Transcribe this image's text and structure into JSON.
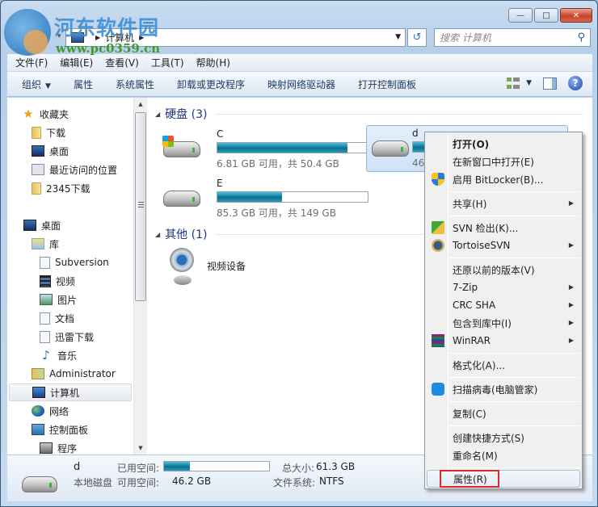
{
  "watermark": {
    "title": "河东软件园",
    "url": "www.pc0359.cn"
  },
  "window": {
    "caption": {
      "minimize": "—",
      "maximize": "□",
      "close": "✕"
    }
  },
  "address": {
    "crumbs": [
      "计算机"
    ],
    "search_placeholder": "搜索 计算机",
    "refresh_glyph": "↺",
    "search_glyph": "⚲"
  },
  "menubar": [
    "文件(F)",
    "编辑(E)",
    "查看(V)",
    "工具(T)",
    "帮助(H)"
  ],
  "toolbar": {
    "items": [
      "组织",
      "属性",
      "系统属性",
      "卸载或更改程序",
      "映射网络驱动器",
      "打开控制面板"
    ],
    "help": "?"
  },
  "nav": {
    "favorites": "收藏夹",
    "downloads": "下载",
    "desktop_fav": "桌面",
    "recent": "最近访问的位置",
    "downloads_2345": "2345下载",
    "desktop": "桌面",
    "library": "库",
    "subversion": "Subversion",
    "videos": "视频",
    "pictures": "图片",
    "documents": "文档",
    "xunlei": "迅雷下载",
    "music": "音乐",
    "administrator": "Administrator",
    "computer": "计算机",
    "network": "网络",
    "control_panel": "控制面板",
    "programs": "程序"
  },
  "groups": {
    "hard_disks": {
      "label": "硬盘 (3)"
    },
    "other": {
      "label": "其他 (1)"
    }
  },
  "drives": [
    {
      "name": "C",
      "info": "6.81 GB 可用，共 50.4 GB",
      "used_fraction": 0.865
    },
    {
      "name": "d",
      "info": "46.2 GB 可用，共 61.3 GB",
      "used_fraction": 0.246
    },
    {
      "name": "E",
      "info": "85.3 GB 可用，共 149 GB",
      "used_fraction": 0.428
    }
  ],
  "devices": [
    {
      "name": "视频设备"
    }
  ],
  "details": {
    "name": "d",
    "type": "本地磁盘",
    "used_label": "已用空间:",
    "used_fraction": 0.246,
    "free_label": "可用空间:",
    "free_value": "46.2 GB",
    "total_label": "总大小:",
    "total_value": "61.3 GB",
    "fs_label": "文件系统:",
    "fs_value": "NTFS"
  },
  "context_menu": {
    "items": [
      {
        "label": "打开(O)"
      },
      {
        "label": "在新窗口中打开(E)"
      },
      {
        "label": "启用 BitLocker(B)..."
      },
      {
        "label": "共享(H)"
      },
      {
        "label": "SVN 检出(K)..."
      },
      {
        "label": "TortoiseSVN"
      },
      {
        "label": "还原以前的版本(V)"
      },
      {
        "label": "7-Zip"
      },
      {
        "label": "CRC SHA"
      },
      {
        "label": "包含到库中(I)"
      },
      {
        "label": "WinRAR"
      },
      {
        "label": "格式化(A)..."
      },
      {
        "label": "扫描病毒(电脑管家)"
      },
      {
        "label": "复制(C)"
      },
      {
        "label": "创建快捷方式(S)"
      },
      {
        "label": "重命名(M)"
      },
      {
        "label": "属性(R)"
      }
    ],
    "highlight_color": "#e02828"
  }
}
